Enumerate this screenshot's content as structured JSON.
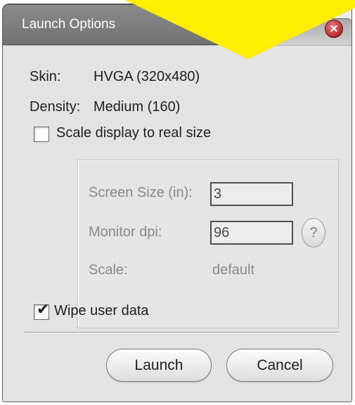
{
  "window": {
    "title": "Launch Options",
    "close_glyph": "✕"
  },
  "info": {
    "skin_label": "Skin:",
    "skin_value": "HVGA (320x480)",
    "density_label": "Density:",
    "density_value": "Medium (160)"
  },
  "scale_display": {
    "label": "Scale display to real size",
    "checked": false
  },
  "scale_group": {
    "screen_size_label": "Screen Size (in):",
    "screen_size_value": "3",
    "monitor_dpi_label": "Monitor dpi:",
    "monitor_dpi_value": "96",
    "help_label": "?",
    "scale_label": "Scale:",
    "scale_value": "default"
  },
  "wipe_user_data": {
    "label": "Wipe user data",
    "checked": true,
    "check_glyph": "✔"
  },
  "buttons": {
    "launch": "Launch",
    "cancel": "Cancel"
  },
  "colors": {
    "banner": "#ffee00",
    "title_bar": "#7f7f7f",
    "close_button": "#b62828",
    "dialog_bg": "#e3e3e3"
  }
}
